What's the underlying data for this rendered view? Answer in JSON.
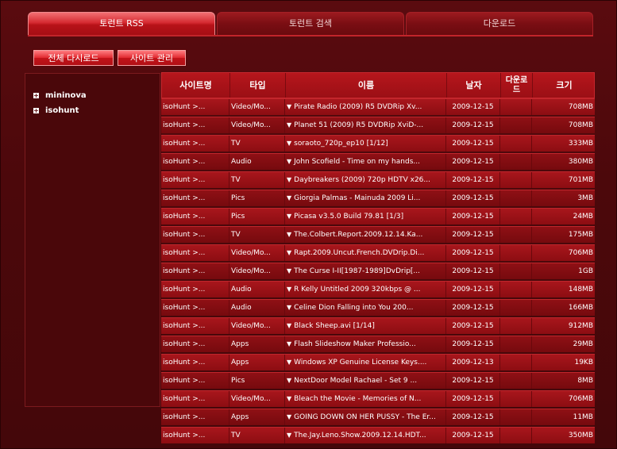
{
  "tabs": [
    {
      "label": "토런트 RSS",
      "active": true
    },
    {
      "label": "토런트 검색",
      "active": false
    },
    {
      "label": "다운로드",
      "active": false
    }
  ],
  "actions": {
    "download_all": "전체 다시로드",
    "site_manage": "사이트 관리"
  },
  "sidebar": {
    "items": [
      {
        "label": "mininova",
        "icon": "plus-box-icon"
      },
      {
        "label": "isohunt",
        "icon": "plus-box-icon"
      }
    ]
  },
  "table": {
    "headers": [
      "사이트명",
      "타입",
      "이름",
      "날자",
      "다운로드",
      "크기"
    ],
    "rows": [
      {
        "site": "isoHunt >...",
        "type": "Video/Mo...",
        "name": "Pirate Radio (2009) R5 DVDRip Xv...",
        "date": "2009-12-15",
        "down": "",
        "size": "708MB"
      },
      {
        "site": "isoHunt >...",
        "type": "Video/Mo...",
        "name": "Planet 51 (2009) R5 DVDRip XviD-...",
        "date": "2009-12-15",
        "down": "",
        "size": "708MB"
      },
      {
        "site": "isoHunt >...",
        "type": "TV",
        "name": "soraoto_720p_ep10 [1/12]",
        "date": "2009-12-15",
        "down": "",
        "size": "333MB"
      },
      {
        "site": "isoHunt >...",
        "type": "Audio",
        "name": "John Scofield - Time on my hands...",
        "date": "2009-12-15",
        "down": "",
        "size": "380MB"
      },
      {
        "site": "isoHunt >...",
        "type": "TV",
        "name": "Daybreakers (2009) 720p HDTV x26...",
        "date": "2009-12-15",
        "down": "",
        "size": "701MB"
      },
      {
        "site": "isoHunt >...",
        "type": "Pics",
        "name": "Giorgia Palmas - Mainuda 2009 Li...",
        "date": "2009-12-15",
        "down": "",
        "size": "3MB"
      },
      {
        "site": "isoHunt >...",
        "type": "Pics",
        "name": "Picasa v3.5.0 Build 79.81 [1/3]",
        "date": "2009-12-15",
        "down": "",
        "size": "24MB"
      },
      {
        "site": "isoHunt >...",
        "type": "TV",
        "name": "The.Colbert.Report.2009.12.14.Ka...",
        "date": "2009-12-15",
        "down": "",
        "size": "175MB"
      },
      {
        "site": "isoHunt >...",
        "type": "Video/Mo...",
        "name": "Rapt.2009.Uncut.French.DVDrip.Di...",
        "date": "2009-12-15",
        "down": "",
        "size": "706MB"
      },
      {
        "site": "isoHunt >...",
        "type": "Video/Mo...",
        "name": "The Curse I-II[1987-1989]DvDrip[...",
        "date": "2009-12-15",
        "down": "",
        "size": "1GB"
      },
      {
        "site": "isoHunt >...",
        "type": "Audio",
        "name": "R Kelly Untitled 2009 320kbps @ ...",
        "date": "2009-12-15",
        "down": "",
        "size": "148MB"
      },
      {
        "site": "isoHunt >...",
        "type": "Audio",
        "name": "Celine Dion Falling into You 200...",
        "date": "2009-12-15",
        "down": "",
        "size": "166MB"
      },
      {
        "site": "isoHunt >...",
        "type": "Video/Mo...",
        "name": "Black Sheep.avi [1/14]",
        "date": "2009-12-15",
        "down": "",
        "size": "912MB"
      },
      {
        "site": "isoHunt >...",
        "type": "Apps",
        "name": "Flash Slideshow Maker Professio...",
        "date": "2009-12-15",
        "down": "",
        "size": "29MB"
      },
      {
        "site": "isoHunt >...",
        "type": "Apps",
        "name": "Windows XP Genuine License Keys....",
        "date": "2009-12-13",
        "down": "",
        "size": "19KB"
      },
      {
        "site": "isoHunt >...",
        "type": "Pics",
        "name": "NextDoor Model Rachael - Set 9 ...",
        "date": "2009-12-15",
        "down": "",
        "size": "8MB"
      },
      {
        "site": "isoHunt >...",
        "type": "Video/Mo...",
        "name": "Bleach the Movie - Memories of N...",
        "date": "2009-12-15",
        "down": "",
        "size": "706MB"
      },
      {
        "site": "isoHunt >...",
        "type": "Apps",
        "name": "GOING DOWN ON HER PUSSY - The Er...",
        "date": "2009-12-15",
        "down": "",
        "size": "11MB"
      },
      {
        "site": "isoHunt >...",
        "type": "TV",
        "name": "The.Jay.Leno.Show.2009.12.14.HDT...",
        "date": "2009-12-15",
        "down": "",
        "size": "350MB"
      }
    ]
  },
  "colors": {
    "background": "#4e0a0d",
    "active_tab": "#d52a31",
    "row": "#a8161c"
  }
}
